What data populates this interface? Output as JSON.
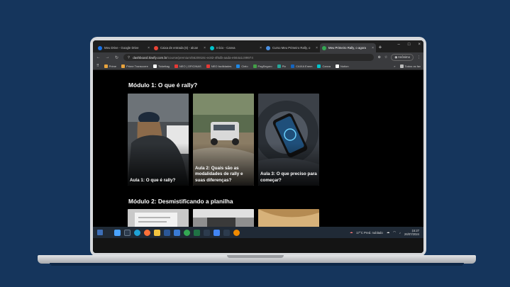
{
  "browser": {
    "tabs": [
      {
        "label": "Meu Drive - Google Drive",
        "color": "#1a73e8"
      },
      {
        "label": "Caixa de entrada (6) - alcan",
        "color": "#ea4335"
      },
      {
        "label": "Início - Canva",
        "color": "#00c4cc"
      },
      {
        "label": "Curso Meu Primeiro Rally, o",
        "color": "#4a90e2"
      },
      {
        "label": "Meu Primeiro Rally, o agora",
        "color": "#34a853",
        "active": true
      }
    ],
    "new_tab": "+",
    "url_host": "dashboard.kiwify.com.br",
    "url_path": "/course/premium/5620918c-ec82-4f6db-aada-e564a1c99974",
    "profile_label": "Anônimo",
    "bookmarks": [
      {
        "label": "Prime",
        "color": "#e8a33d"
      },
      {
        "label": "Prime Transcorre",
        "color": "#e8a33d"
      },
      {
        "label": "Tickettag",
        "color": "#ffffff"
      },
      {
        "label": "NEO | OFICINAS",
        "color": "#e53935"
      },
      {
        "label": "NEO facilidades",
        "color": "#e53935"
      },
      {
        "label": "Cielo",
        "color": "#1e88e5"
      },
      {
        "label": "PagSeguro",
        "color": "#43a047"
      },
      {
        "label": "Pix",
        "color": "#26a69a"
      },
      {
        "label": "CAIXA Enem",
        "color": "#1565c0"
      },
      {
        "label": "Canva",
        "color": "#00c4cc"
      },
      {
        "label": "Notion",
        "color": "#ffffff"
      }
    ],
    "all_bookmarks": "Todos os fav"
  },
  "page": {
    "modules": [
      {
        "title": "Módulo 1: O que é rally?",
        "lessons": [
          {
            "title": "Aula 1: O que é rally?",
            "scene": "person"
          },
          {
            "title": "Aula 2: Quais são as modalidades de rally e suas diferenças?",
            "scene": "truck"
          },
          {
            "title": "Aula 3: O que preciso para começar?",
            "scene": "phone"
          }
        ]
      },
      {
        "title": "Módulo 2: Desmistificando a planilha",
        "lessons": [
          {
            "title": "",
            "scene": "paper"
          },
          {
            "title": "",
            "scene": "car"
          },
          {
            "title": "",
            "scene": "hair"
          }
        ]
      }
    ]
  },
  "taskbar": {
    "weather": "17°C  Pred. nublado",
    "time": "15:27",
    "date": "26/07/2024"
  }
}
